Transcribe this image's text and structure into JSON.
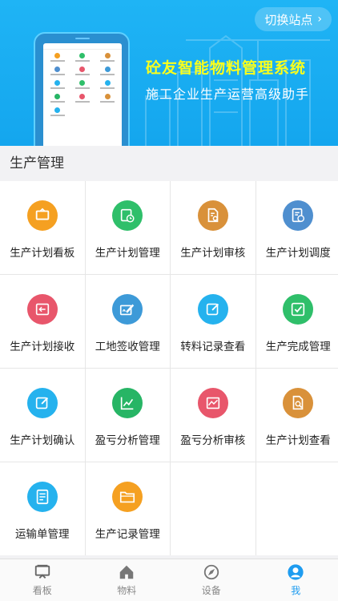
{
  "banner": {
    "switch_label": "切换站点",
    "title": "砼友智能物料管理系统",
    "subtitle": "施工企业生产运营高级助手",
    "title_color": "#fbff1c",
    "bg_color": "#17aaf0"
  },
  "section": {
    "title": "生产管理"
  },
  "modules": [
    {
      "label": "生产计划看板",
      "icon": "board-icon",
      "color": "#f5a021"
    },
    {
      "label": "生产计划管理",
      "icon": "calendar-clock-icon",
      "color": "#2fbf6a"
    },
    {
      "label": "生产计划审核",
      "icon": "document-gear-icon",
      "color": "#d9913a"
    },
    {
      "label": "生产计划调度",
      "icon": "document-clock-icon",
      "color": "#4f8fcf"
    },
    {
      "label": "生产计划接收",
      "icon": "inbox-arrow-icon",
      "color": "#e8566b"
    },
    {
      "label": "工地签收管理",
      "icon": "sign-pen-icon",
      "color": "#3d9ad8"
    },
    {
      "label": "转料记录查看",
      "icon": "edit-square-icon",
      "color": "#25b2ee"
    },
    {
      "label": "生产完成管理",
      "icon": "check-square-icon",
      "color": "#2fbf6a"
    },
    {
      "label": "生产计划确认",
      "icon": "edit-square-icon",
      "color": "#25b2ee"
    },
    {
      "label": "盈亏分析管理",
      "icon": "trend-chart-icon",
      "color": "#27b565"
    },
    {
      "label": "盈亏分析审核",
      "icon": "line-chart-icon",
      "color": "#e8566b"
    },
    {
      "label": "生产计划查看",
      "icon": "search-document-icon",
      "color": "#d9913a"
    },
    {
      "label": "运输单管理",
      "icon": "transport-doc-icon",
      "color": "#25b2ee"
    },
    {
      "label": "生产记录管理",
      "icon": "folder-icon",
      "color": "#f5a021"
    }
  ],
  "tabbar": {
    "items": [
      {
        "label": "看板",
        "icon": "board-tab-icon"
      },
      {
        "label": "物料",
        "icon": "home-tab-icon"
      },
      {
        "label": "设备",
        "icon": "navigation-tab-icon"
      },
      {
        "label": "我",
        "icon": "user-tab-icon"
      }
    ],
    "active_index": 3,
    "active_color": "#1e9cf0"
  }
}
